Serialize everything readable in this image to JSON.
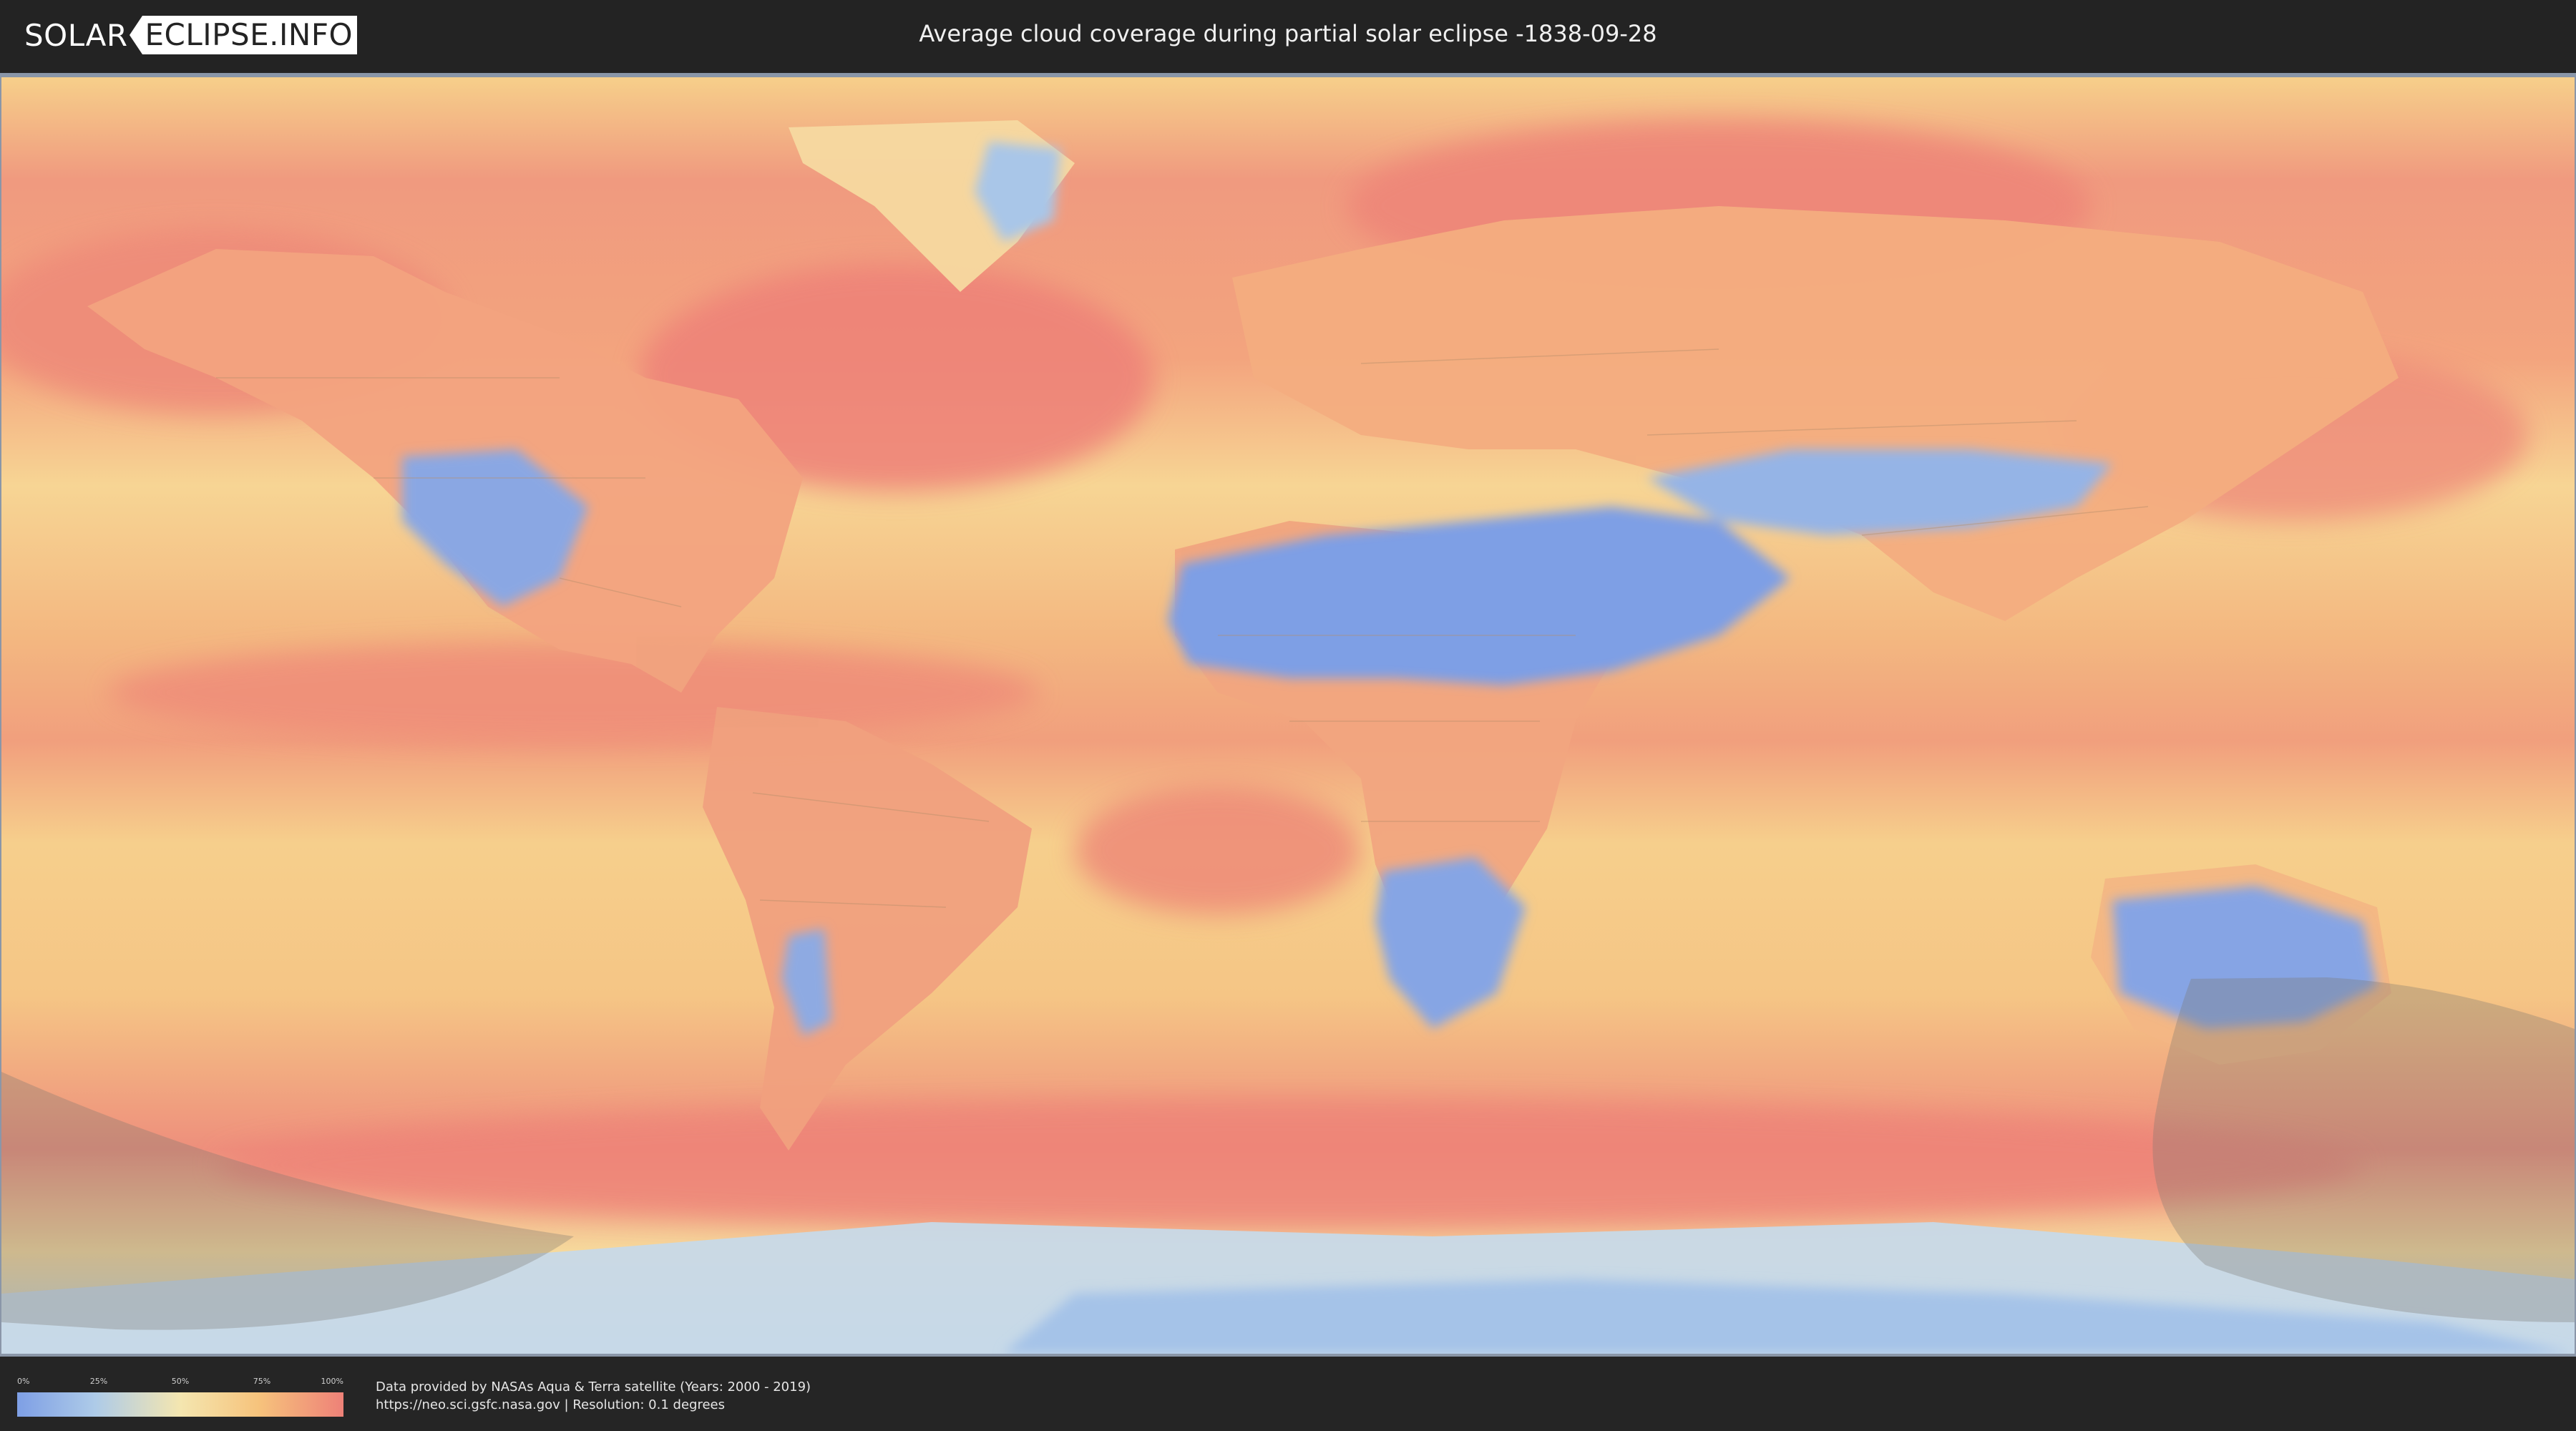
{
  "header": {
    "logo_left": "SOLAR",
    "logo_right": "ECLIPSE.INFO",
    "title": "Average cloud coverage during partial solar eclipse -1838-09-28"
  },
  "map": {
    "colors": {
      "clear_sky": "#7e9fe5",
      "low_cloud": "#aecbe8",
      "mid_cloud": "#f4e6b0",
      "high_cloud": "#f6c37c",
      "full_cloud": "#ee8178",
      "eclipse_shadow": "#7a7670"
    }
  },
  "legend": {
    "ticks": [
      "0%",
      "25%",
      "50%",
      "75%",
      "100%"
    ],
    "tick_values": [
      0,
      25,
      50,
      75,
      100
    ]
  },
  "footer": {
    "credit_line": "Data provided by NASAs Aqua & Terra satellite (Years: 2000 - 2019)",
    "source_line": "https://neo.sci.gsfc.nasa.gov | Resolution: 0.1 degrees"
  }
}
